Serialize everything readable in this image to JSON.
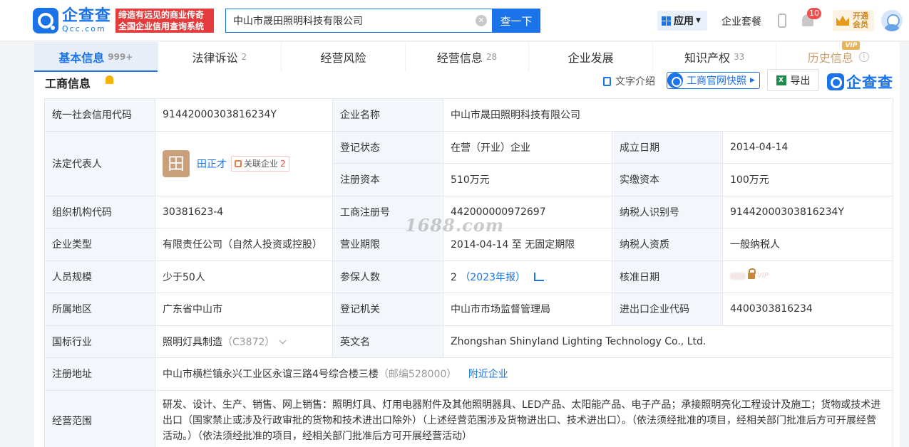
{
  "header": {
    "logo_cn": "企查查",
    "logo_en": "Qcc.com",
    "slogan_line1": "缔造有远见的商业传奇",
    "slogan_line2": "全国企业信用查询系统",
    "search_value": "中山市晟田照明科技有限公司",
    "search_button": "查一下",
    "apps_label": "应用",
    "package_label": "企业套餐",
    "notification_count": "10",
    "vip_label": "开通会员"
  },
  "tabs": [
    {
      "label": "基本信息",
      "count": "999+"
    },
    {
      "label": "法律诉讼",
      "count": "2"
    },
    {
      "label": "经营风险",
      "count": ""
    },
    {
      "label": "经营信息",
      "count": "28"
    },
    {
      "label": "企业发展",
      "count": ""
    },
    {
      "label": "知识产权",
      "count": "33"
    },
    {
      "label": "历史信息",
      "count": "",
      "tag": "VIP"
    }
  ],
  "section": {
    "title": "工商信息",
    "text_intro": "文字介绍",
    "gs_snapshot": "工商官网快照",
    "export": "导出",
    "brand": "企查查"
  },
  "info": {
    "credit_code_label": "统一社会信用代码",
    "credit_code": "91442000303816234Y",
    "company_name_label": "企业名称",
    "company_name": "中山市晟田照明科技有限公司",
    "legal_rep_label": "法定代表人",
    "legal_rep_avatar": "田",
    "legal_rep": "田正才",
    "assoc_label": "关联企业",
    "assoc_count": "2",
    "reg_status_label": "登记状态",
    "reg_status": "在营（开业）企业",
    "est_date_label": "成立日期",
    "est_date": "2014-04-14",
    "reg_capital_label": "注册资本",
    "reg_capital": "510万元",
    "paid_capital_label": "实缴资本",
    "paid_capital": "100万元",
    "org_code_label": "组织机构代码",
    "org_code": "30381623-4",
    "reg_no_label": "工商注册号",
    "reg_no": "442000000972697",
    "taxpayer_id_label": "纳税人识别号",
    "taxpayer_id": "91442000303816234Y",
    "type_label": "企业类型",
    "type": "有限责任公司（自然人投资或控股）",
    "term_label": "营业期限",
    "term": "2014-04-14 至 无固定期限",
    "taxpayer_qual_label": "纳税人资质",
    "taxpayer_qual": "一般纳税人",
    "staff_label": "人员规模",
    "staff": "少于50人",
    "insured_label": "参保人数",
    "insured": "2",
    "insured_report": "（2023年报）",
    "approval_label": "核准日期",
    "approval_vip": "VIP",
    "region_label": "所属地区",
    "region": "广东省中山市",
    "authority_label": "登记机关",
    "authority": "中山市市场监督管理局",
    "ie_code_label": "进出口企业代码",
    "ie_code": "4400303816234",
    "industry_label": "国标行业",
    "industry": "照明灯具制造",
    "industry_code": "（C3872）",
    "en_name_label": "英文名",
    "en_name": "Zhongshan Shinyland Lighting Technology Co., Ltd.",
    "address_label": "注册地址",
    "address": "中山市横栏镇永兴工业区永谊三路4号综合楼三楼",
    "postcode": "（邮编528000）",
    "nearby": "附近企业",
    "scope_label": "经营范围",
    "scope": "研发、设计、生产、销售、网上销售：照明灯具、灯用电器附件及其他照明器具、LED产品、太阳能产品、电子产品；承接照明亮化工程设计及施工；货物或技术进出口（国家禁止或涉及行政审批的货物和技术进出口除外）（上述经营范围涉及货物进出口、技术进出口）。（依法须经批准的项目，经相关部门批准后方可开展经营活动。）（依法须经批准的项目，经相关部门批准后方可开展经营活动）"
  },
  "watermark": "1688.com"
}
